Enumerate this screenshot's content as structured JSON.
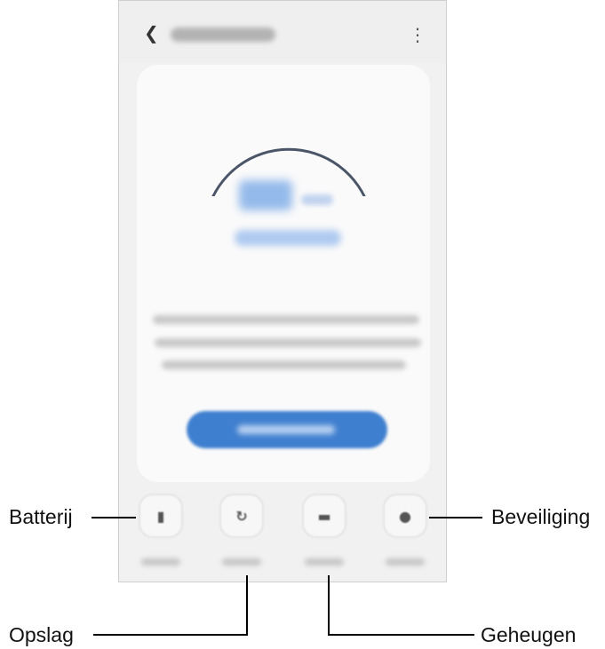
{
  "callouts": {
    "battery": "Batterij",
    "security": "Beveiliging",
    "storage": "Opslag",
    "memory": "Geheugen"
  },
  "screen": {
    "back_icon": "chevron-left-icon",
    "more_icon": "more-vert-icon",
    "tiles": [
      {
        "name": "battery",
        "icon": "battery-icon"
      },
      {
        "name": "storage",
        "icon": "storage-icon"
      },
      {
        "name": "memory",
        "icon": "memory-icon"
      },
      {
        "name": "security",
        "icon": "shield-icon"
      }
    ]
  },
  "colors": {
    "accent": "#3f7fcf",
    "gauge": "#4a5568",
    "background": "#f1f1f1"
  }
}
